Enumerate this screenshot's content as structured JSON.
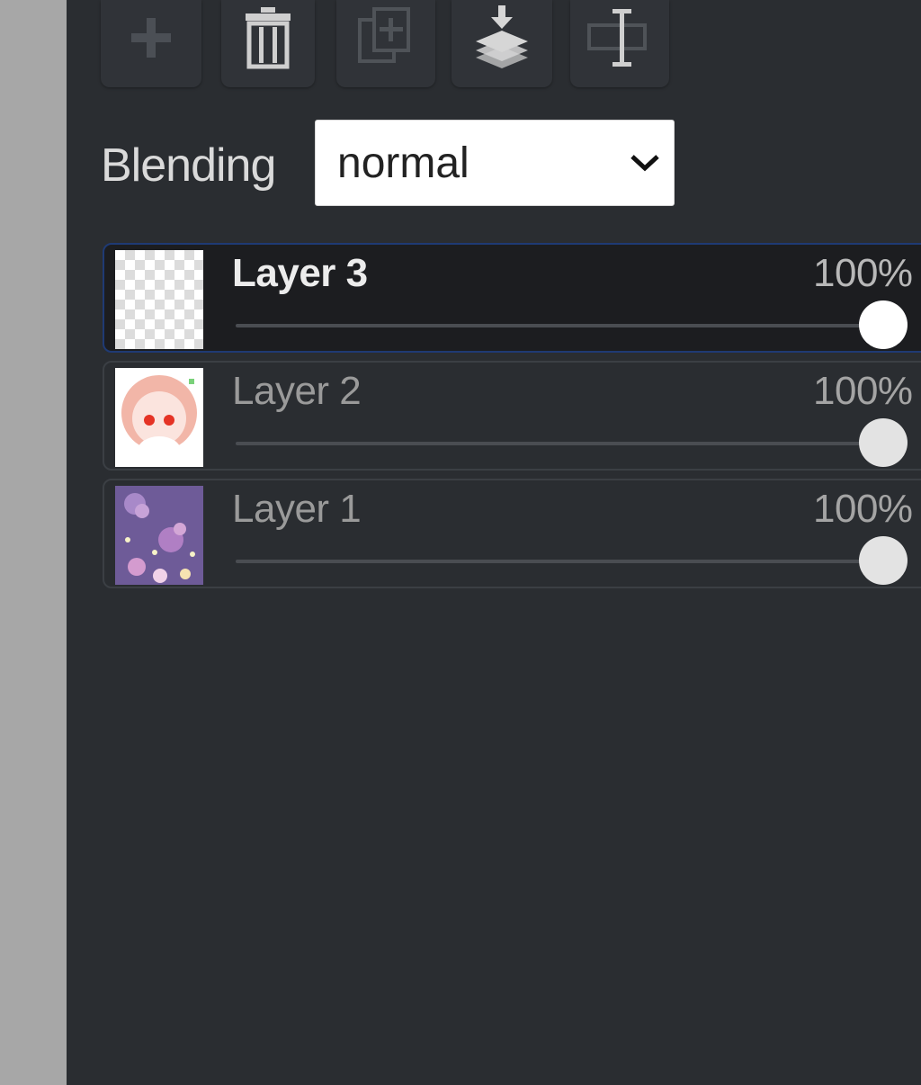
{
  "toolbar": {
    "buttons": [
      {
        "name": "add-layer",
        "icon": "plus-icon",
        "enabled": false
      },
      {
        "name": "delete-layer",
        "icon": "trash-icon",
        "enabled": true
      },
      {
        "name": "duplicate-layer",
        "icon": "duplicate-icon",
        "enabled": false
      },
      {
        "name": "merge-down",
        "icon": "merge-down-icon",
        "enabled": true
      },
      {
        "name": "rename-layer",
        "icon": "rename-icon",
        "enabled": false
      }
    ]
  },
  "blending": {
    "label": "Blending",
    "selected": "normal"
  },
  "layers": [
    {
      "name": "Layer 3",
      "opacity_label": "100%",
      "opacity": 1.0,
      "selected": true,
      "thumbnail": "transparent"
    },
    {
      "name": "Layer 2",
      "opacity_label": "100%",
      "opacity": 1.0,
      "selected": false,
      "thumbnail": "character-face"
    },
    {
      "name": "Layer 1",
      "opacity_label": "100%",
      "opacity": 1.0,
      "selected": false,
      "thumbnail": "purple-background"
    }
  ],
  "colors": {
    "panel_bg": "#2a2d31",
    "selected_row_bg": "#1c1d20",
    "selected_row_border": "#1f3a74"
  }
}
